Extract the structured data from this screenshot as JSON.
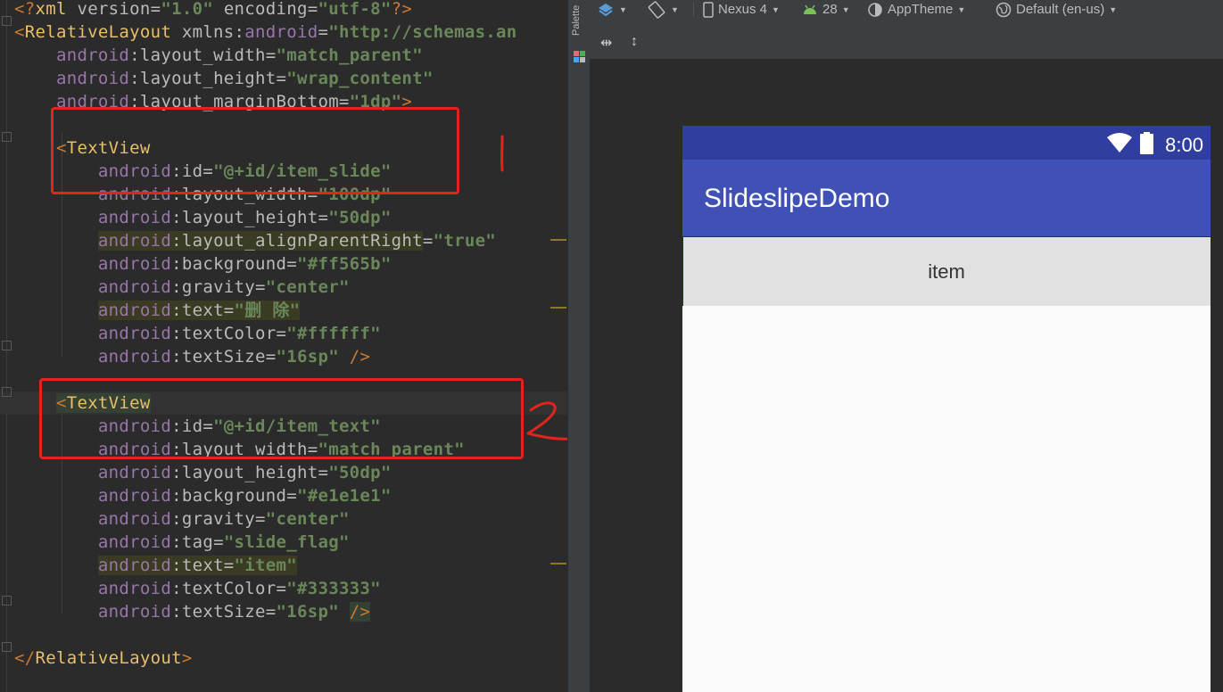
{
  "editor": {
    "lines": [
      [
        {
          "c": "t-punct",
          "t": "<?"
        },
        {
          "c": "t-tag",
          "t": "xml "
        },
        {
          "c": "t-attr",
          "t": "version="
        },
        {
          "c": "t-val",
          "t": "\"1.0\" "
        },
        {
          "c": "t-attr",
          "t": "encoding="
        },
        {
          "c": "t-val",
          "t": "\"utf-8\""
        },
        {
          "c": "t-punct",
          "t": "?>"
        }
      ],
      [
        {
          "c": "t-punct",
          "t": "<"
        },
        {
          "c": "t-tag",
          "t": "RelativeLayout "
        },
        {
          "c": "t-attr",
          "t": "xmlns:"
        },
        {
          "c": "t-ns",
          "t": "android"
        },
        {
          "c": "t-attr",
          "t": "="
        },
        {
          "c": "t-val",
          "t": "\"http://schemas.an"
        }
      ],
      [
        {
          "c": "t-attr",
          "t": "    "
        },
        {
          "c": "t-ns",
          "t": "android"
        },
        {
          "c": "t-attr",
          "t": ":layout_width="
        },
        {
          "c": "t-val",
          "t": "\"match_parent\""
        }
      ],
      [
        {
          "c": "t-attr",
          "t": "    "
        },
        {
          "c": "t-ns",
          "t": "android"
        },
        {
          "c": "t-attr",
          "t": ":layout_height="
        },
        {
          "c": "t-val",
          "t": "\"wrap_content\""
        }
      ],
      [
        {
          "c": "t-attr",
          "t": "    "
        },
        {
          "c": "t-ns",
          "t": "android"
        },
        {
          "c": "t-attr",
          "t": ":layout_marginBottom="
        },
        {
          "c": "t-val",
          "t": "\"1dp\""
        },
        {
          "c": "t-punct",
          "t": ">"
        }
      ],
      [],
      [
        {
          "c": "t-attr",
          "t": "    "
        },
        {
          "c": "t-punct",
          "t": "<"
        },
        {
          "c": "t-tag",
          "t": "TextView"
        }
      ],
      [
        {
          "c": "t-attr",
          "t": "        "
        },
        {
          "c": "t-ns",
          "t": "android"
        },
        {
          "c": "t-attr",
          "t": ":id="
        },
        {
          "c": "t-val",
          "t": "\"@+id/item_slide\""
        }
      ],
      [
        {
          "c": "t-attr",
          "t": "        "
        },
        {
          "c": "t-ns",
          "t": "android"
        },
        {
          "c": "t-attr",
          "t": ":layout_width="
        },
        {
          "c": "t-val",
          "t": "\"100dp\""
        }
      ],
      [
        {
          "c": "t-attr",
          "t": "        "
        },
        {
          "c": "t-ns",
          "t": "android"
        },
        {
          "c": "t-attr",
          "t": ":layout_height="
        },
        {
          "c": "t-val",
          "t": "\"50dp\""
        }
      ],
      [
        {
          "c": "t-attr",
          "t": "        "
        },
        {
          "c": "t-ns warn",
          "t": "android"
        },
        {
          "c": "t-attr warn",
          "t": ":layout_alignParentRight"
        },
        {
          "c": "t-attr",
          "t": "="
        },
        {
          "c": "t-val",
          "t": "\"true\""
        }
      ],
      [
        {
          "c": "t-attr",
          "t": "        "
        },
        {
          "c": "t-ns",
          "t": "android"
        },
        {
          "c": "t-attr",
          "t": ":background="
        },
        {
          "c": "t-val",
          "t": "\"#ff565b\""
        }
      ],
      [
        {
          "c": "t-attr",
          "t": "        "
        },
        {
          "c": "t-ns",
          "t": "android"
        },
        {
          "c": "t-attr",
          "t": ":gravity="
        },
        {
          "c": "t-val",
          "t": "\"center\""
        }
      ],
      [
        {
          "c": "t-attr",
          "t": "        "
        },
        {
          "c": "t-ns warn",
          "t": "android"
        },
        {
          "c": "t-attr warn",
          "t": ":text="
        },
        {
          "c": "t-val warn",
          "t": "\"删 除\""
        }
      ],
      [
        {
          "c": "t-attr",
          "t": "        "
        },
        {
          "c": "t-ns",
          "t": "android"
        },
        {
          "c": "t-attr",
          "t": ":textColor="
        },
        {
          "c": "t-val",
          "t": "\"#ffffff\""
        }
      ],
      [
        {
          "c": "t-attr",
          "t": "        "
        },
        {
          "c": "t-ns",
          "t": "android"
        },
        {
          "c": "t-attr",
          "t": ":textSize="
        },
        {
          "c": "t-val",
          "t": "\"16sp\" "
        },
        {
          "c": "t-punct",
          "t": "/>"
        }
      ],
      [],
      [
        {
          "c": "t-attr",
          "t": "    "
        },
        {
          "c": "t-punct hl",
          "t": "<"
        },
        {
          "c": "t-tag hl",
          "t": "TextView"
        }
      ],
      [
        {
          "c": "t-attr",
          "t": "        "
        },
        {
          "c": "t-ns",
          "t": "android"
        },
        {
          "c": "t-attr",
          "t": ":id="
        },
        {
          "c": "t-val",
          "t": "\"@+id/item_text\""
        }
      ],
      [
        {
          "c": "t-attr",
          "t": "        "
        },
        {
          "c": "t-ns",
          "t": "android"
        },
        {
          "c": "t-attr",
          "t": ":layout_width="
        },
        {
          "c": "t-val",
          "t": "\"match_parent\""
        }
      ],
      [
        {
          "c": "t-attr",
          "t": "        "
        },
        {
          "c": "t-ns",
          "t": "android"
        },
        {
          "c": "t-attr",
          "t": ":layout_height="
        },
        {
          "c": "t-val",
          "t": "\"50dp\""
        }
      ],
      [
        {
          "c": "t-attr",
          "t": "        "
        },
        {
          "c": "t-ns",
          "t": "android"
        },
        {
          "c": "t-attr",
          "t": ":background="
        },
        {
          "c": "t-val",
          "t": "\"#e1e1e1\""
        }
      ],
      [
        {
          "c": "t-attr",
          "t": "        "
        },
        {
          "c": "t-ns",
          "t": "android"
        },
        {
          "c": "t-attr",
          "t": ":gravity="
        },
        {
          "c": "t-val",
          "t": "\"center\""
        }
      ],
      [
        {
          "c": "t-attr",
          "t": "        "
        },
        {
          "c": "t-ns",
          "t": "android"
        },
        {
          "c": "t-attr",
          "t": ":tag="
        },
        {
          "c": "t-val",
          "t": "\"slide_flag\""
        }
      ],
      [
        {
          "c": "t-attr",
          "t": "        "
        },
        {
          "c": "t-ns warn",
          "t": "android"
        },
        {
          "c": "t-attr warn",
          "t": ":text="
        },
        {
          "c": "t-val warn",
          "t": "\"item\""
        }
      ],
      [
        {
          "c": "t-attr",
          "t": "        "
        },
        {
          "c": "t-ns",
          "t": "android"
        },
        {
          "c": "t-attr",
          "t": ":textColor="
        },
        {
          "c": "t-val",
          "t": "\"#333333\""
        }
      ],
      [
        {
          "c": "t-attr",
          "t": "        "
        },
        {
          "c": "t-ns",
          "t": "android"
        },
        {
          "c": "t-attr",
          "t": ":textSize="
        },
        {
          "c": "t-val",
          "t": "\"16sp\" "
        },
        {
          "c": "t-punct hl",
          "t": "/>"
        }
      ],
      [],
      [
        {
          "c": "t-punct",
          "t": "</"
        },
        {
          "c": "t-tag",
          "t": "RelativeLayout"
        },
        {
          "c": "t-punct",
          "t": ">"
        }
      ]
    ],
    "annotation_1": "1",
    "annotation_2": "2"
  },
  "palette": {
    "label": "Palette"
  },
  "toolbar": {
    "device": "Nexus 4",
    "api": "28",
    "theme": "AppTheme",
    "locale": "Default (en-us)"
  },
  "preview": {
    "clock": "8:00",
    "app_title": "SlideslipeDemo",
    "item_text": "item",
    "colors": {
      "status_bar": "#303f9f",
      "app_bar": "#3f51b5",
      "item_background": "#e1e1e1",
      "item_text": "#333333"
    }
  }
}
